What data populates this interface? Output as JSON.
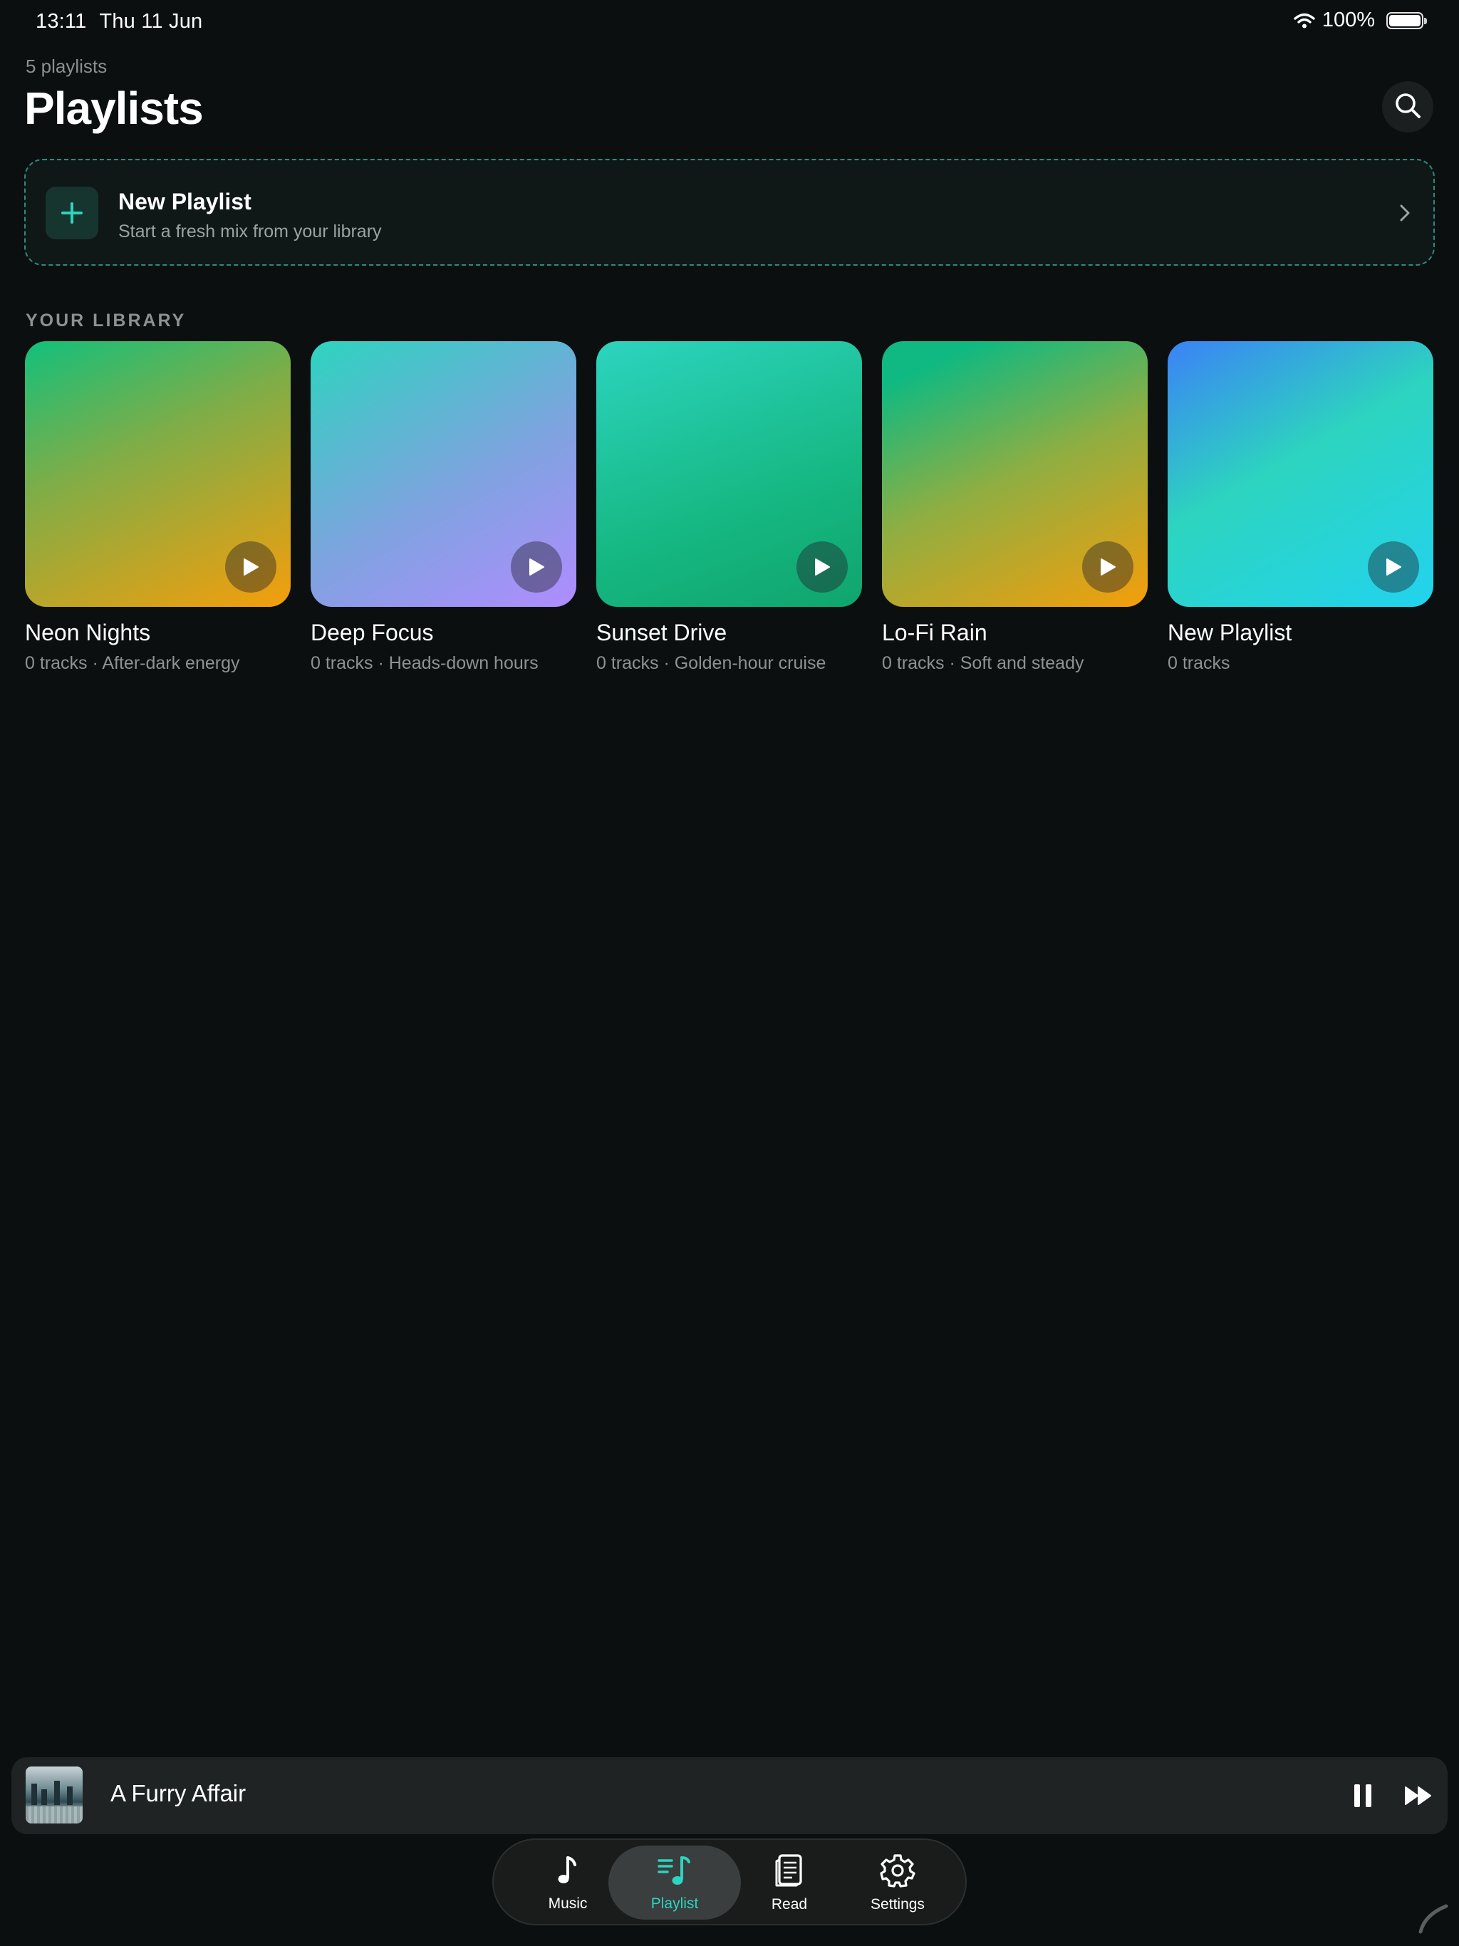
{
  "status_bar": {
    "time": "13:11",
    "date": "Thu 11 Jun",
    "battery": "100%"
  },
  "header": {
    "count": "5 playlists",
    "title": "Playlists",
    "search_icon": "search-icon"
  },
  "new_playlist": {
    "title": "New Playlist",
    "subtitle": "Start a fresh mix from your library",
    "icon": "plus-icon"
  },
  "library": {
    "heading": "YOUR LIBRARY",
    "playlists": [
      {
        "name": "Neon Nights",
        "meta": "0 tracks · After-dark energy"
      },
      {
        "name": "Deep Focus",
        "meta": "0 tracks · Heads-down hours"
      },
      {
        "name": "Sunset Drive",
        "meta": "0 tracks · Golden-hour cruise"
      },
      {
        "name": "Lo-Fi Rain",
        "meta": "0 tracks · Soft and steady"
      },
      {
        "name": "New Playlist",
        "meta": "0 tracks"
      }
    ]
  },
  "now_playing": {
    "track": "A Furry Affair"
  },
  "tabs": [
    {
      "label": "Music",
      "icon": "music-note-icon",
      "active": false
    },
    {
      "label": "Playlist",
      "icon": "playlist-icon",
      "active": true
    },
    {
      "label": "Read",
      "icon": "document-icon",
      "active": false
    },
    {
      "label": "Settings",
      "icon": "gear-icon",
      "active": false
    }
  ],
  "colors": {
    "background": "#0b0f0f",
    "accent": "#2dd4bf",
    "card_border": "#2c8b80"
  }
}
